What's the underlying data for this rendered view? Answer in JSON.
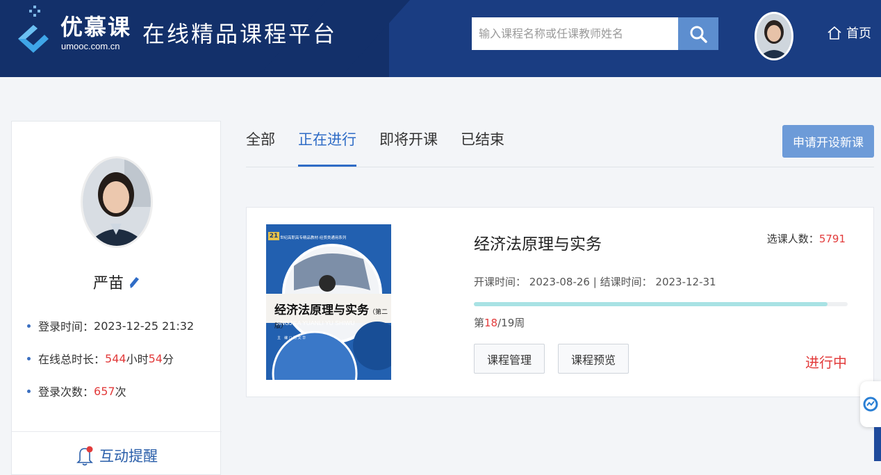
{
  "header": {
    "brand_name": "优慕课",
    "brand_url": "umooc.com.cn",
    "platform_title": "在线精品课程平台",
    "search_placeholder": "输入课程名称或任课教师姓名",
    "home_label": "首页"
  },
  "profile": {
    "name": "严苗",
    "login_time_label": "登录时间：",
    "login_time": "2023-12-25 21:32",
    "online_label": "在线总时长：",
    "online_hours": "544",
    "hours_unit": "小时",
    "online_minutes": "54",
    "minutes_unit": "分",
    "login_count_label": "登录次数：",
    "login_count": "657",
    "count_unit": "次",
    "interact_label": "互动提醒"
  },
  "tabs": [
    {
      "label": "全部",
      "active": false
    },
    {
      "label": "正在进行",
      "active": true
    },
    {
      "label": "即将开课",
      "active": false
    },
    {
      "label": "已结束",
      "active": false
    }
  ],
  "apply_button": "申请开设新课",
  "course": {
    "title": "经济法原理与实务",
    "enroll_label": "选课人数：",
    "enroll_count": "5791",
    "start_label": "开课时间：",
    "start_date": "2023-08-26",
    "separator": "|",
    "end_label": "结课时间：",
    "end_date": "2023-12-31",
    "week_prefix": "第",
    "week_current": "18",
    "week_total": "/19周",
    "progress_fraction": 0.947,
    "manage_button": "课程管理",
    "preview_button": "课程预览",
    "status": "进行中",
    "cover": {
      "num": "21",
      "series": "世纪高职高专精品教材·经贸类通用系列",
      "title": "经济法原理与实务",
      "edition": "（第二版）",
      "pinyin": "JINGJIFA YUANLI YU SHIWU",
      "author": "主　编  □ 杨 文 华"
    }
  },
  "colors": {
    "header_bg": "#1a3d82",
    "accent": "#2f6cc6",
    "highlight_red": "#e23b3b",
    "progress": "#a8e2e4"
  }
}
